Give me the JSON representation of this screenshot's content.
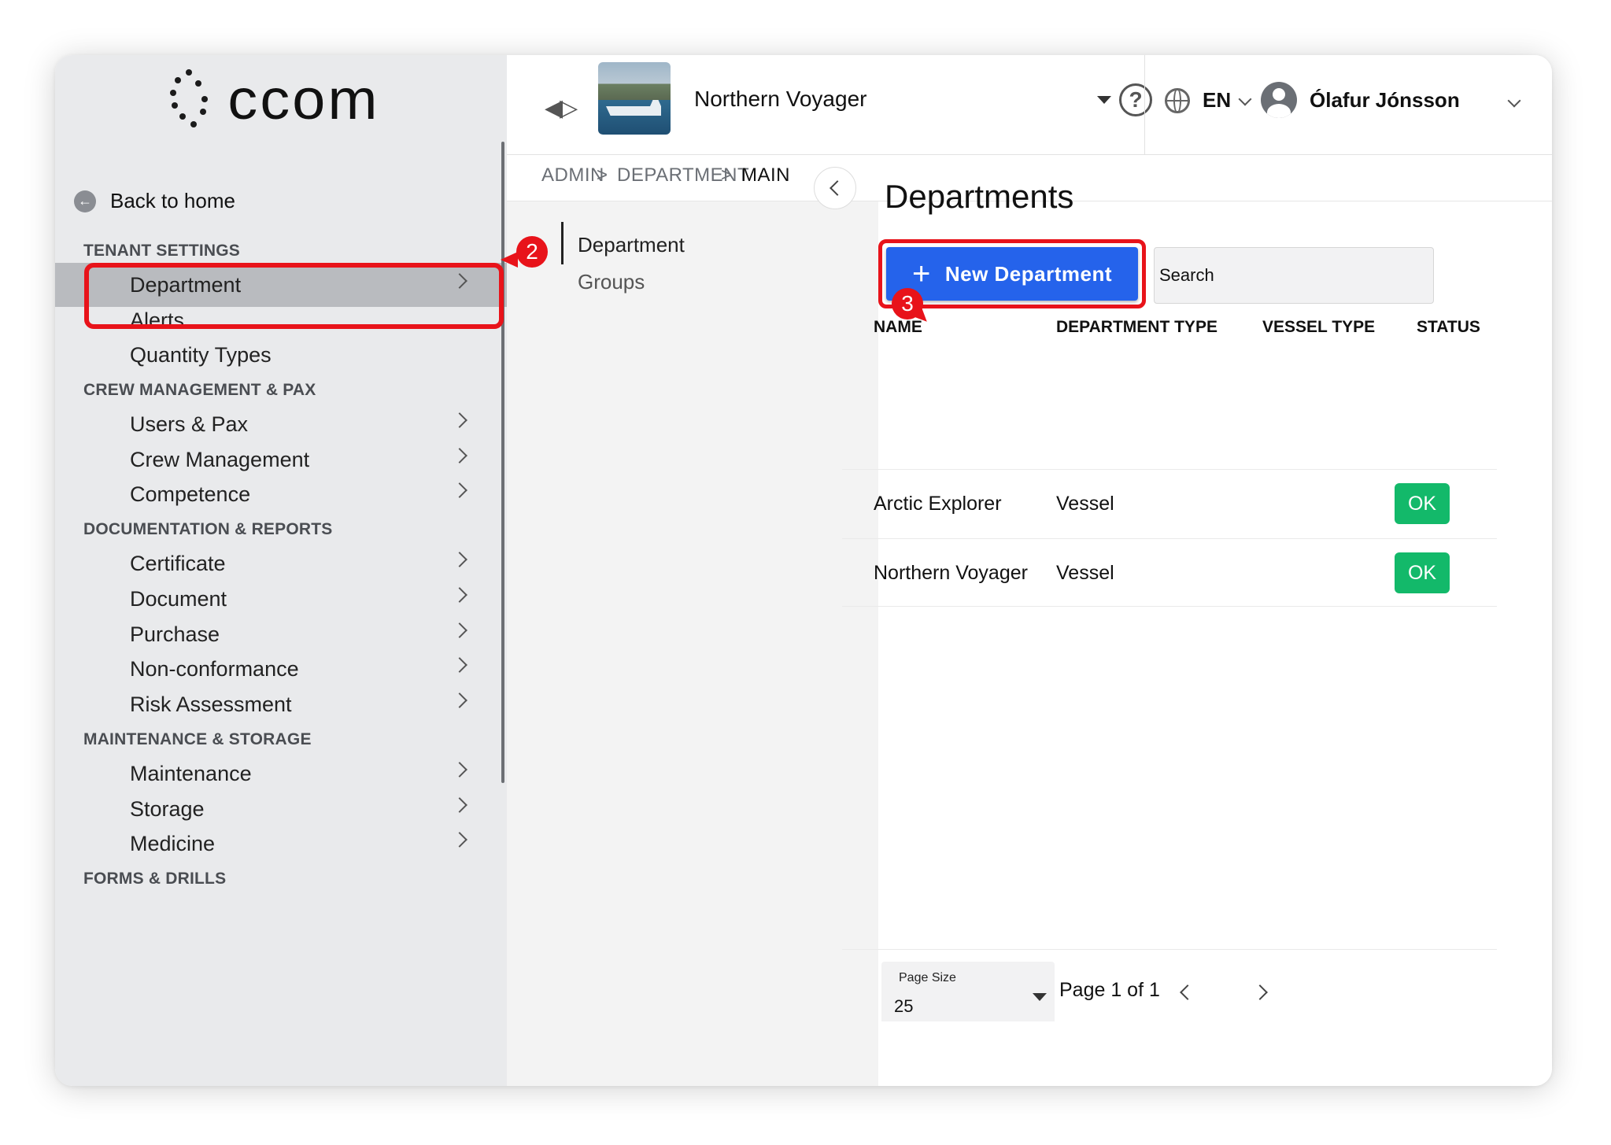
{
  "app": {
    "logo_text": "ccom"
  },
  "topbar": {
    "vessel_name": "Northern Voyager",
    "language": "EN",
    "user_name": "Ólafur Jónsson"
  },
  "breadcrumb": {
    "items": [
      "ADMIN",
      ">",
      "DEPARTMENT",
      ">",
      "MAIN"
    ]
  },
  "sidebar": {
    "back_label": "Back to home",
    "sections": [
      {
        "title": "TENANT SETTINGS"
      },
      {
        "title": "CREW MANAGEMENT & PAX"
      },
      {
        "title": "DOCUMENTATION & REPORTS"
      },
      {
        "title": "MAINTENANCE & STORAGE"
      },
      {
        "title": "FORMS & DRILLS"
      }
    ],
    "items": [
      {
        "label": "Department",
        "chevron": true,
        "active": true
      },
      {
        "label": "Alerts",
        "chevron": false
      },
      {
        "label": "Quantity Types",
        "chevron": false
      },
      {
        "label": "Users & Pax",
        "chevron": true
      },
      {
        "label": "Crew Management",
        "chevron": true
      },
      {
        "label": "Competence",
        "chevron": true
      },
      {
        "label": "Certificate",
        "chevron": true
      },
      {
        "label": "Document",
        "chevron": true
      },
      {
        "label": "Purchase",
        "chevron": true
      },
      {
        "label": "Non-conformance",
        "chevron": true
      },
      {
        "label": "Risk Assessment",
        "chevron": true
      },
      {
        "label": "Maintenance",
        "chevron": true
      },
      {
        "label": "Storage",
        "chevron": true
      },
      {
        "label": "Medicine",
        "chevron": true
      }
    ]
  },
  "subnav": {
    "items": [
      "Department",
      "Groups"
    ]
  },
  "main": {
    "title": "Departments",
    "new_button_label": "New Department",
    "search_placeholder": "Search",
    "columns": [
      "NAME",
      "DEPARTMENT TYPE",
      "VESSEL TYPE",
      "STATUS"
    ],
    "rows": [
      {
        "name": "Arctic Explorer",
        "department_type": "Vessel",
        "vessel_type": "",
        "status": "OK"
      },
      {
        "name": "Northern Voyager",
        "department_type": "Vessel",
        "vessel_type": "",
        "status": "OK"
      }
    ],
    "pagination": {
      "page_size_label": "Page Size",
      "page_size": "25",
      "page_info": "Page 1 of 1"
    }
  },
  "annotations": {
    "step2": "2",
    "step3": "3",
    "color": "#e8131a"
  },
  "colors": {
    "primary_button": "#2563eb",
    "status_ok": "#13b96a",
    "sidebar_bg": "#e9eaec",
    "active_item": "#b9bbbf"
  }
}
